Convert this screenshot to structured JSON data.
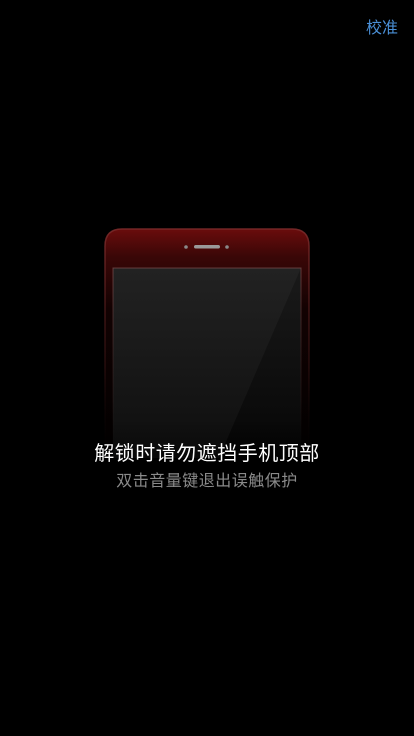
{
  "header": {
    "calibrate_label": "校准"
  },
  "prompt": {
    "title": "解锁时请勿遮挡手机顶部",
    "subtitle": "双击音量键退出误触保护"
  },
  "colors": {
    "accent": "#4a8fd6",
    "phone_top": "#5a0a0a"
  },
  "illustration": {
    "icon": "phone-front-icon"
  }
}
